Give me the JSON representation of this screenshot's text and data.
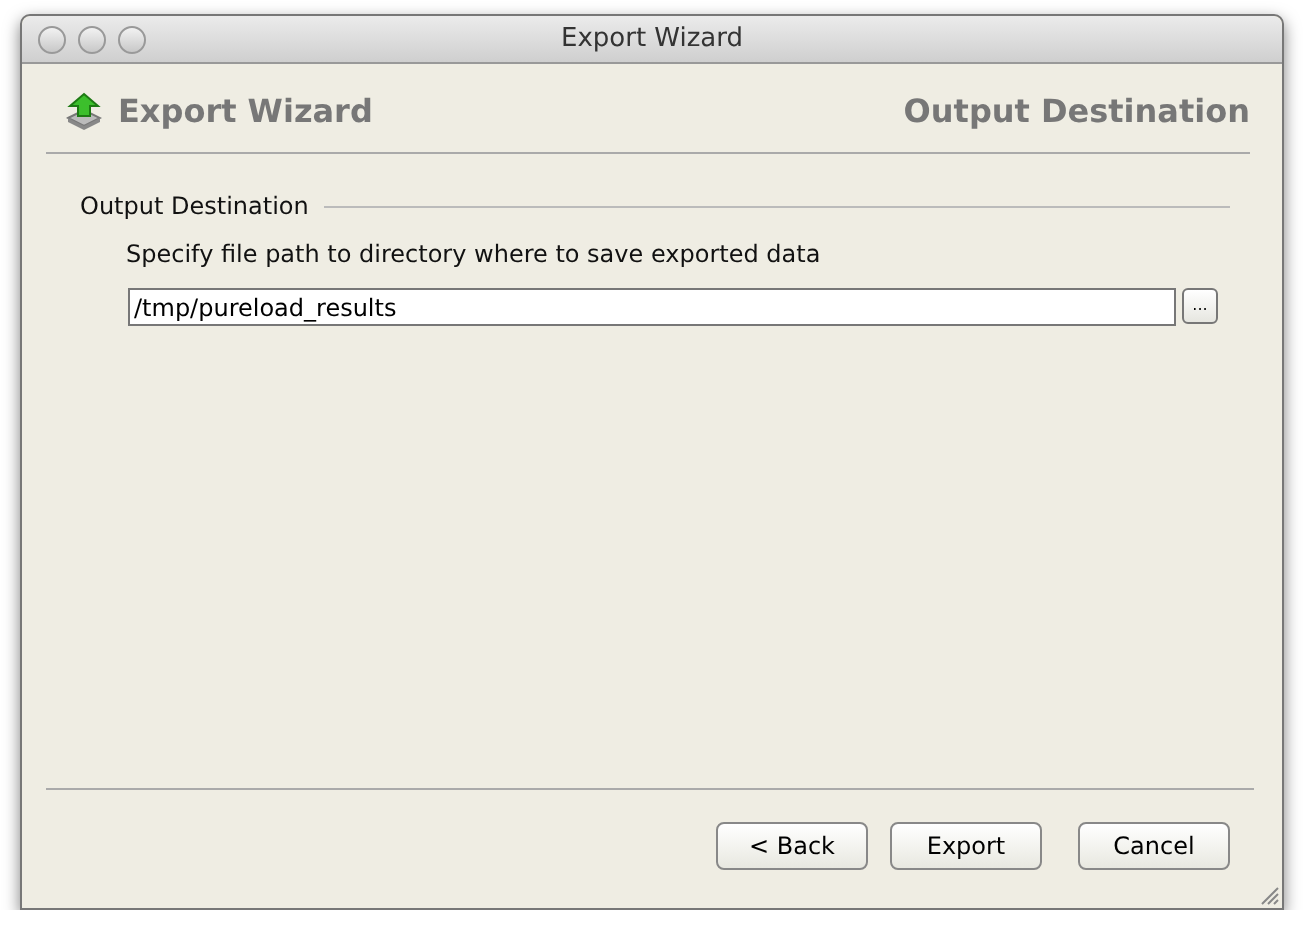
{
  "window": {
    "title": "Export Wizard"
  },
  "header": {
    "title": "Export Wizard",
    "step": "Output Destination"
  },
  "group": {
    "label": "Output Destination",
    "description": "Specify file path to directory where to save exported data",
    "path": "/tmp/pureload_results",
    "browse": "..."
  },
  "buttons": [
    {
      "label": "< Back"
    },
    {
      "label": "Export"
    },
    {
      "label": "Cancel"
    }
  ]
}
